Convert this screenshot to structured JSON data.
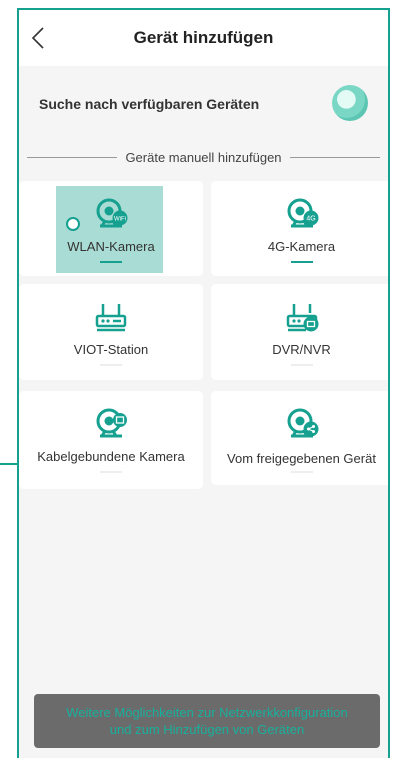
{
  "header": {
    "title": "Gerät hinzufügen"
  },
  "search": {
    "text": "Suche nach verfügbaren Geräten"
  },
  "divider": {
    "text": "Geräte manuell hinzufügen"
  },
  "devices": [
    {
      "label": "WLAN-Kamera",
      "icon": "wifi-camera-icon"
    },
    {
      "label": "4G-Kamera",
      "icon": "4g-camera-icon"
    },
    {
      "label": "VIOT-Station",
      "icon": "station-icon"
    },
    {
      "label": "DVR/NVR",
      "icon": "dvr-nvr-icon"
    },
    {
      "label": "Kabelgebundene Kamera",
      "icon": "wired-camera-icon"
    },
    {
      "label": "Vom freigegebenen Gerät",
      "icon": "shared-camera-icon"
    }
  ],
  "bottom": {
    "line1": "Weitere Möglichkeiten zur Netzwerkkonfiguration",
    "line2": "und zum Hinzufügen von Geräten"
  },
  "colors": {
    "accent": "#15a08f",
    "highlight": "#a9dcd4",
    "button_bg": "#6b6b6b"
  }
}
